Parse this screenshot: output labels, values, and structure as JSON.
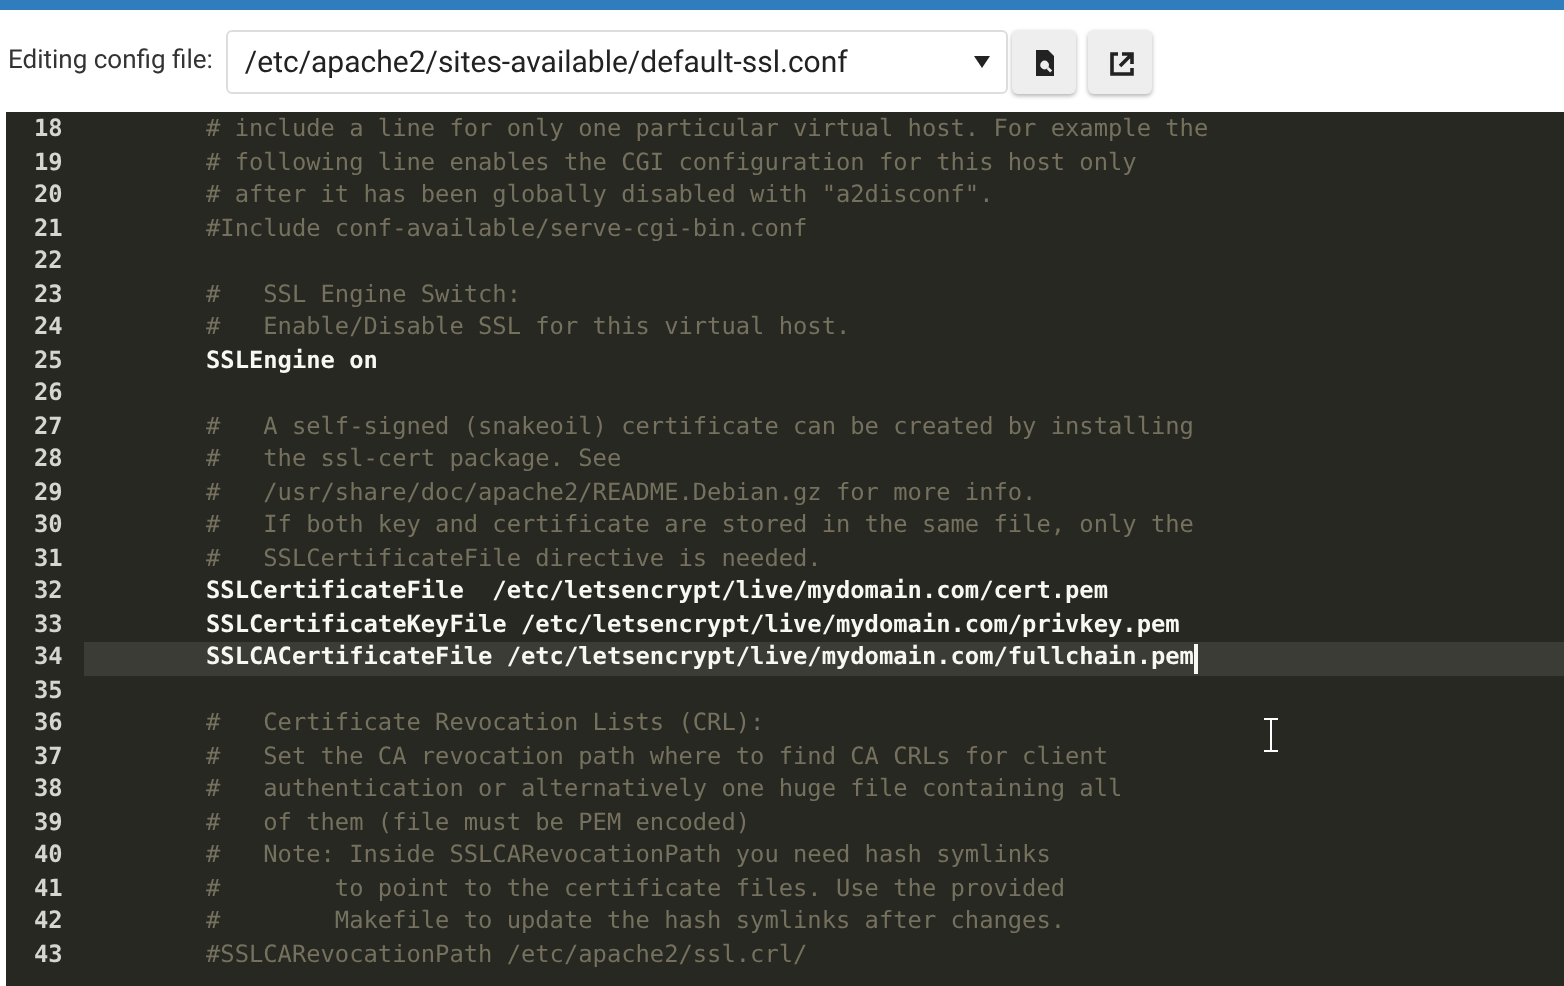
{
  "toolbar": {
    "label": "Editing config file:",
    "file_select": {
      "value": "/etc/apache2/sites-available/default-ssl.conf"
    },
    "buttons": [
      {
        "kind": "preview"
      },
      {
        "kind": "open-external"
      }
    ]
  },
  "editor": {
    "lines": [
      {
        "number": "18",
        "kind": "comment",
        "text": "# include a line for only one particular virtual host. For example the",
        "active": false
      },
      {
        "number": "19",
        "kind": "comment",
        "text": "# following line enables the CGI configuration for this host only",
        "active": false
      },
      {
        "number": "20",
        "kind": "comment",
        "text": "# after it has been globally disabled with \"a2disconf\".",
        "active": false
      },
      {
        "number": "21",
        "kind": "comment",
        "text": "#Include conf-available/serve-cgi-bin.conf",
        "active": false
      },
      {
        "number": "22",
        "kind": "blank",
        "active": false
      },
      {
        "number": "23",
        "kind": "comment",
        "text": "#   SSL Engine Switch:",
        "active": false
      },
      {
        "number": "24",
        "kind": "comment",
        "text": "#   Enable/Disable SSL for this virtual host.",
        "active": false
      },
      {
        "number": "25",
        "kind": "directive",
        "text": "SSLEngine on",
        "active": false
      },
      {
        "number": "26",
        "kind": "blank",
        "active": false
      },
      {
        "number": "27",
        "kind": "comment",
        "text": "#   A self-signed (snakeoil) certificate can be created by installing",
        "active": false
      },
      {
        "number": "28",
        "kind": "comment",
        "text": "#   the ssl-cert package. See",
        "active": false
      },
      {
        "number": "29",
        "kind": "comment",
        "text": "#   /usr/share/doc/apache2/README.Debian.gz for more info.",
        "active": false
      },
      {
        "number": "30",
        "kind": "comment",
        "text": "#   If both key and certificate are stored in the same file, only the",
        "active": false
      },
      {
        "number": "31",
        "kind": "comment",
        "text": "#   SSLCertificateFile directive is needed.",
        "active": false
      },
      {
        "number": "32",
        "kind": "directive",
        "text": "SSLCertificateFile  /etc/letsencrypt/live/mydomain.com/cert.pem",
        "active": false
      },
      {
        "number": "33",
        "kind": "directive",
        "text": "SSLCertificateKeyFile /etc/letsencrypt/live/mydomain.com/privkey.pem",
        "active": false
      },
      {
        "number": "34",
        "kind": "directive",
        "text": "SSLCACertificateFile /etc/letsencrypt/live/mydomain.com/fullchain.pem",
        "active": true
      },
      {
        "number": "35",
        "kind": "blank",
        "active": false
      },
      {
        "number": "36",
        "kind": "comment",
        "text": "#   Certificate Revocation Lists (CRL):",
        "active": false
      },
      {
        "number": "37",
        "kind": "comment",
        "text": "#   Set the CA revocation path where to find CA CRLs for client",
        "active": false
      },
      {
        "number": "38",
        "kind": "comment",
        "text": "#   authentication or alternatively one huge file containing all",
        "active": false
      },
      {
        "number": "39",
        "kind": "comment",
        "text": "#   of them (file must be PEM encoded)",
        "active": false
      },
      {
        "number": "40",
        "kind": "comment",
        "text": "#   Note: Inside SSLCARevocationPath you need hash symlinks",
        "active": false
      },
      {
        "number": "41",
        "kind": "comment",
        "text": "#        to point to the certificate files. Use the provided",
        "active": false
      },
      {
        "number": "42",
        "kind": "comment",
        "text": "#        Makefile to update the hash symlinks after changes.",
        "active": false
      },
      {
        "number": "43",
        "kind": "comment",
        "text": "#SSLCARevocationPath /etc/apache2/ssl.crl/",
        "active": false
      }
    ]
  }
}
